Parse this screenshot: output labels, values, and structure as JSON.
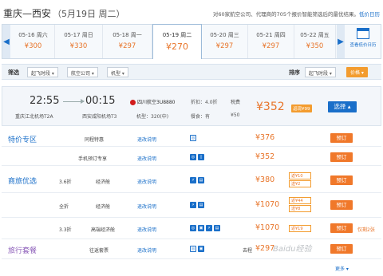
{
  "header": {
    "route": "重庆—西安",
    "date": "（5月19日 周二）",
    "note": "对60家航空公司、代理商的705个报价智能筛选后的最优结果。",
    "note_link": "低价日历"
  },
  "datebar": {
    "prev": "◀",
    "next": "▶",
    "dates": [
      {
        "label": "05-16 周六",
        "price": "¥300"
      },
      {
        "label": "05-17 周日",
        "price": "¥330"
      },
      {
        "label": "05-18 周一",
        "price": "¥297"
      },
      {
        "label": "05-19 周二",
        "price": "¥270"
      },
      {
        "label": "05-20 周三",
        "price": "¥297"
      },
      {
        "label": "05-21 周四",
        "price": "¥297"
      },
      {
        "label": "05-22 周五",
        "price": "¥350"
      }
    ],
    "calendar_label": "查看低价日历"
  },
  "filter": {
    "label": "筛选",
    "dropdowns": [
      "起飞时段",
      "航空公司",
      "机型"
    ],
    "sort_label": "排序",
    "sort_dropdown": "起飞时段",
    "sort_button": "价格 ▾"
  },
  "flight": {
    "dep_time": "22:55",
    "arr_time": "00:15",
    "dep_airport": "重庆江北机场T2A",
    "arr_airport": "西安咸阳机场T3",
    "airline": "四川航空3U8880",
    "aircraft": "机型：320(中)",
    "discount": "折扣：4.0折",
    "meal": "餐食：有",
    "tax_label": "税费",
    "tax": "¥50",
    "price": "¥352",
    "badge": "返现¥99",
    "select": "选择 ▴"
  },
  "sections": {
    "special": "特价专区",
    "business": "商旅优选",
    "travel": "旅行套餐"
  },
  "rows": [
    {
      "discount": "",
      "product": "同程特惠",
      "rule": "退改说明",
      "price": "¥376",
      "book": "预订"
    },
    {
      "discount": "",
      "product": "手机预订专享",
      "rule": "退改说明",
      "price": "¥352",
      "book": "预订"
    },
    {
      "discount": "3.6折",
      "product": "经济舱",
      "rule": "退改说明",
      "price": "¥380",
      "cashback": [
        "返¥10",
        "送¥2"
      ],
      "book": "预订"
    },
    {
      "discount": "全折",
      "product": "经济舱",
      "rule": "退改说明",
      "price": "¥1070",
      "cashback": [
        "返¥44",
        "送¥8"
      ],
      "book": "预订"
    },
    {
      "discount": "3.3折",
      "product": "高端经济舱",
      "rule": "退改说明",
      "price": "¥1070",
      "cashback": [
        "返¥19"
      ],
      "book": "预订",
      "extra": "仅剩2张"
    },
    {
      "discount": "",
      "product": "往返套票",
      "rule": "退改说明",
      "price_label": "去程",
      "price": "¥297",
      "book": "预订"
    }
  ],
  "more": "更多 ▾",
  "watermark": "Baidu经验"
}
